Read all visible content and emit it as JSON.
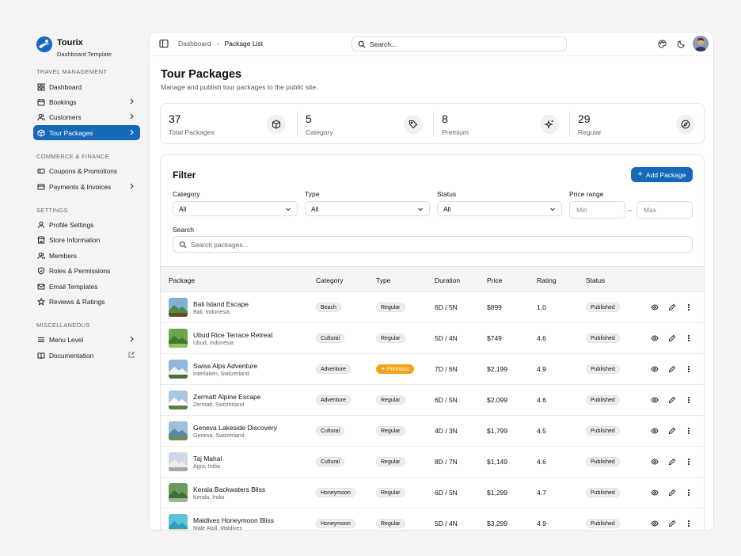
{
  "brand": {
    "name": "Tourix",
    "subtitle": "Dashboard Template"
  },
  "sidebar": {
    "sections": [
      {
        "title": "TRAVEL MANAGEMENT",
        "items": [
          {
            "label": "Dashboard",
            "icon": "dashboard-icon",
            "chevron": false
          },
          {
            "label": "Bookings",
            "icon": "calendar-icon",
            "chevron": true
          },
          {
            "label": "Customers",
            "icon": "users-icon",
            "chevron": true
          },
          {
            "label": "Tour Packages",
            "icon": "package-icon",
            "chevron": true,
            "active": true
          }
        ]
      },
      {
        "title": "COMMERCE & FINANCE",
        "items": [
          {
            "label": "Coupons & Promotions",
            "icon": "ticket-icon",
            "chevron": false
          },
          {
            "label": "Payments & Invoices",
            "icon": "credit-card-icon",
            "chevron": true
          }
        ]
      },
      {
        "title": "SETTINGS",
        "items": [
          {
            "label": "Profile Settings",
            "icon": "user-icon",
            "chevron": false
          },
          {
            "label": "Store Information",
            "icon": "store-icon",
            "chevron": false
          },
          {
            "label": "Members",
            "icon": "members-icon",
            "chevron": false
          },
          {
            "label": "Roles & Permissions",
            "icon": "shield-icon",
            "chevron": false
          },
          {
            "label": "Email Templates",
            "icon": "mail-icon",
            "chevron": false
          },
          {
            "label": "Reviews & Ratings",
            "icon": "star-icon",
            "chevron": false
          }
        ]
      },
      {
        "title": "MISCELLANEOUS",
        "items": [
          {
            "label": "Menu Level",
            "icon": "menu-icon",
            "chevron": true
          },
          {
            "label": "Documentation",
            "icon": "book-icon",
            "chevron": false,
            "external": true
          }
        ]
      }
    ]
  },
  "topbar": {
    "breadcrumb": [
      "Dashboard",
      "Package List"
    ],
    "search_placeholder": "Search..."
  },
  "page": {
    "title": "Tour Packages",
    "subtitle": "Manage and publish tour packages to the public site."
  },
  "stats": [
    {
      "value": "37",
      "label": "Total Packages",
      "icon": "box-icon"
    },
    {
      "value": "5",
      "label": "Category",
      "icon": "tag-icon"
    },
    {
      "value": "8",
      "label": "Premium",
      "icon": "sparkles-icon"
    },
    {
      "value": "29",
      "label": "Regular",
      "icon": "compass-icon"
    }
  ],
  "filter": {
    "title": "Filter",
    "add_button": "Add Package",
    "category_label": "Category",
    "category_value": "All",
    "type_label": "Type",
    "type_value": "All",
    "status_label": "Status",
    "status_value": "All",
    "price_label": "Price range",
    "price_min_placeholder": "Min",
    "price_max_placeholder": "Max",
    "price_separator": "–",
    "search_label": "Search",
    "search_placeholder": "Search packages..."
  },
  "table": {
    "columns": [
      "Package",
      "Category",
      "Type",
      "Duration",
      "Price",
      "Rating",
      "Status"
    ],
    "rows": [
      {
        "name": "Bali Island Escape",
        "location": "Bali, Indonesia",
        "category": "Beach",
        "type": "Regular",
        "duration": "6D / 5N",
        "price": "$899",
        "rating": "1.0",
        "status": "Published"
      },
      {
        "name": "Ubud Rice Terrace Retreat",
        "location": "Ubud, Indonesia",
        "category": "Cultural",
        "type": "Regular",
        "duration": "5D / 4N",
        "price": "$749",
        "rating": "4.6",
        "status": "Published"
      },
      {
        "name": "Swiss Alps Adventure",
        "location": "Interlaken, Switzerland",
        "category": "Adventure",
        "type": "Premium",
        "duration": "7D / 6N",
        "price": "$2,199",
        "rating": "4.9",
        "status": "Published"
      },
      {
        "name": "Zermatt Alpine Escape",
        "location": "Zermatt, Switzerland",
        "category": "Adventure",
        "type": "Regular",
        "duration": "6D / 5N",
        "price": "$2,099",
        "rating": "4.6",
        "status": "Published"
      },
      {
        "name": "Geneva Lakeside Discovery",
        "location": "Geneva, Switzerland",
        "category": "Cultural",
        "type": "Regular",
        "duration": "4D / 3N",
        "price": "$1,799",
        "rating": "4.5",
        "status": "Published"
      },
      {
        "name": "Taj Mahal",
        "location": "Agra, India",
        "category": "Cultural",
        "type": "Regular",
        "duration": "8D / 7N",
        "price": "$1,149",
        "rating": "4.6",
        "status": "Published"
      },
      {
        "name": "Kerala Backwaters Bliss",
        "location": "Kerala, India",
        "category": "Honeymoon",
        "type": "Regular",
        "duration": "6D / 5N",
        "price": "$1,299",
        "rating": "4.7",
        "status": "Published"
      },
      {
        "name": "Maldives Honeymoon Bliss",
        "location": "Male Atoll, Maldives",
        "category": "Honeymoon",
        "type": "Regular",
        "duration": "5D / 4N",
        "price": "$3,299",
        "rating": "4.9",
        "status": "Published"
      }
    ]
  },
  "colors": {
    "accent": "#1668b8",
    "premium": "#f5a21a"
  }
}
